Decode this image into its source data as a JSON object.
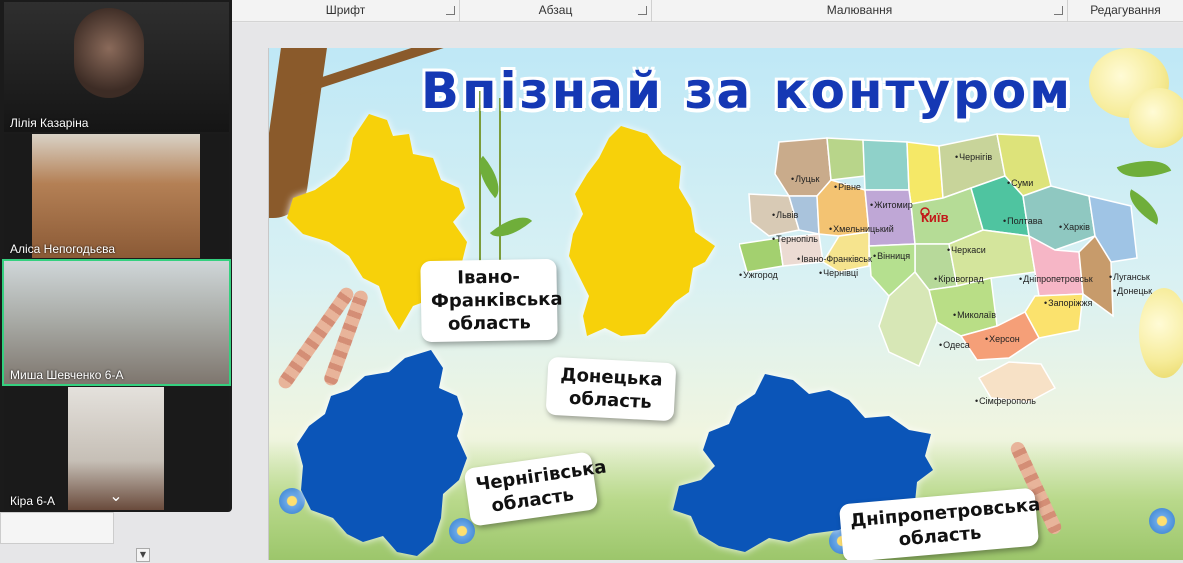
{
  "ribbon": {
    "groups": [
      "Шрифт",
      "Абзац",
      "Малювання",
      "Редагування"
    ]
  },
  "slide": {
    "title": "Впізнай за контуром",
    "labels": {
      "ivano": "Івано-\nФранківська\nобласть",
      "donetsk": "Донецька\nобласть",
      "chernihiv": "Чернігівська\nобласть",
      "dnipro": "Дніпропетровська\nобласть"
    },
    "shape_colors": {
      "yellow": "#f7d10a",
      "blue": "#0b55b8"
    },
    "map": {
      "capital": "Київ",
      "cities": [
        "Луцьк",
        "Рівне",
        "Житомир",
        "Чернігів",
        "Суми",
        "Львів",
        "Тернопіль",
        "Хмельницький",
        "Полтава",
        "Харків",
        "Ужгород",
        "Івано-Франківськ",
        "Вінниця",
        "Черкаси",
        "Чернівці",
        "Кіровоград",
        "Дніпропетровськ",
        "Луганськ",
        "Донецьк",
        "Запоріжжя",
        "Миколаїв",
        "Одеса",
        "Херсон",
        "Сімферополь"
      ]
    }
  },
  "participants": [
    {
      "name": "Лілія Казаріна"
    },
    {
      "name": "Аліса Непогодьєва"
    },
    {
      "name": "Миша Шевченко 6-А"
    },
    {
      "name": "Кіра 6-А"
    }
  ]
}
